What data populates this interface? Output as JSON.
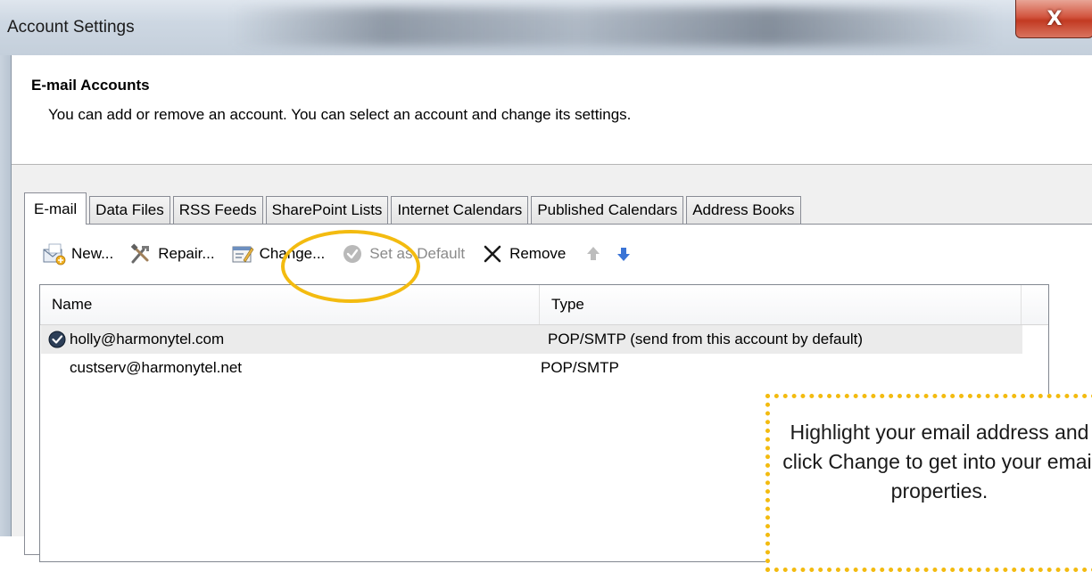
{
  "window": {
    "title": "Account Settings",
    "close_glyph": "X"
  },
  "header": {
    "title": "E-mail Accounts",
    "subtitle": "You can add or remove an account. You can select an account and change its settings."
  },
  "tabs": [
    {
      "label": "E-mail",
      "active": true
    },
    {
      "label": "Data Files",
      "active": false
    },
    {
      "label": "RSS Feeds",
      "active": false
    },
    {
      "label": "SharePoint Lists",
      "active": false
    },
    {
      "label": "Internet Calendars",
      "active": false
    },
    {
      "label": "Published Calendars",
      "active": false
    },
    {
      "label": "Address Books",
      "active": false
    }
  ],
  "toolbar": {
    "new_label": "New...",
    "repair_label": "Repair...",
    "change_label": "Change...",
    "set_default_label": "Set as Default",
    "remove_label": "Remove",
    "icons": [
      "new-account-icon",
      "repair-tools-icon",
      "change-settings-icon",
      "checkmark-icon",
      "x-icon",
      "up-arrow-icon",
      "down-arrow-icon"
    ]
  },
  "list": {
    "columns": [
      "Name",
      "Type"
    ],
    "rows": [
      {
        "name": "holly@harmonytel.com",
        "type": "POP/SMTP (send from this account by default)",
        "default": true,
        "selected": true
      },
      {
        "name": "custserv@harmonytel.net",
        "type": "POP/SMTP",
        "default": false,
        "selected": false
      }
    ]
  },
  "callout": {
    "text": "Highlight your email address and click Change to get into your email properties."
  },
  "colors": {
    "annotation": "#f3bb10",
    "close_button": "#c23a22",
    "selected_row": "#ebebeb"
  }
}
